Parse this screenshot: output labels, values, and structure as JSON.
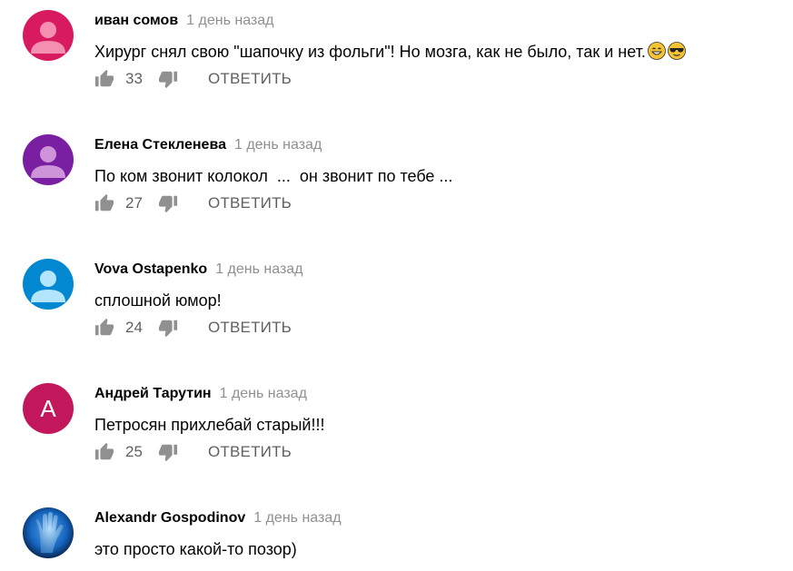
{
  "comments": [
    {
      "author": "иван сомов",
      "time": "1 день назад",
      "text": "Хирург снял свою \"шапочку из фольги\"! Но мозга, как не было, так и нет.",
      "emojis": [
        "grinning-face-icon",
        "sunglasses-face-icon"
      ],
      "likes": "33",
      "reply_label": "ОТВЕТИТЬ",
      "avatar": {
        "type": "person",
        "bg": "#d81b60",
        "fg": "#f48fb1"
      }
    },
    {
      "author": "Елена Стекленева",
      "time": "1 день назад",
      "text": "По ком звонит колокол  ...  он звонит по тебе ...",
      "likes": "27",
      "reply_label": "ОТВЕТИТЬ",
      "avatar": {
        "type": "person",
        "bg": "#7b1fa2",
        "fg": "#ce93d8"
      }
    },
    {
      "author": "Vova Ostapenko",
      "time": "1 день назад",
      "text": "сплошной юмор!",
      "likes": "24",
      "reply_label": "ОТВЕТИТЬ",
      "avatar": {
        "type": "person",
        "bg": "#0288d1",
        "fg": "#b3e5fc"
      }
    },
    {
      "author": "Андрей Тарутин",
      "time": "1 день назад",
      "text": "Петросян прихлебай старый!!!",
      "likes": "25",
      "reply_label": "ОТВЕТИТЬ",
      "avatar": {
        "type": "letter",
        "letter": "A",
        "bg": "#c2185b"
      }
    },
    {
      "author": "Alexandr Gospodinov",
      "time": "1 день назад",
      "text": "это просто какой-то позор)",
      "avatar": {
        "type": "photo",
        "bg": "#0d47a1",
        "subject": "blue-hand-photo"
      }
    }
  ],
  "colors": {
    "author": "#030303",
    "meta": "#909090",
    "action": "#606060"
  }
}
